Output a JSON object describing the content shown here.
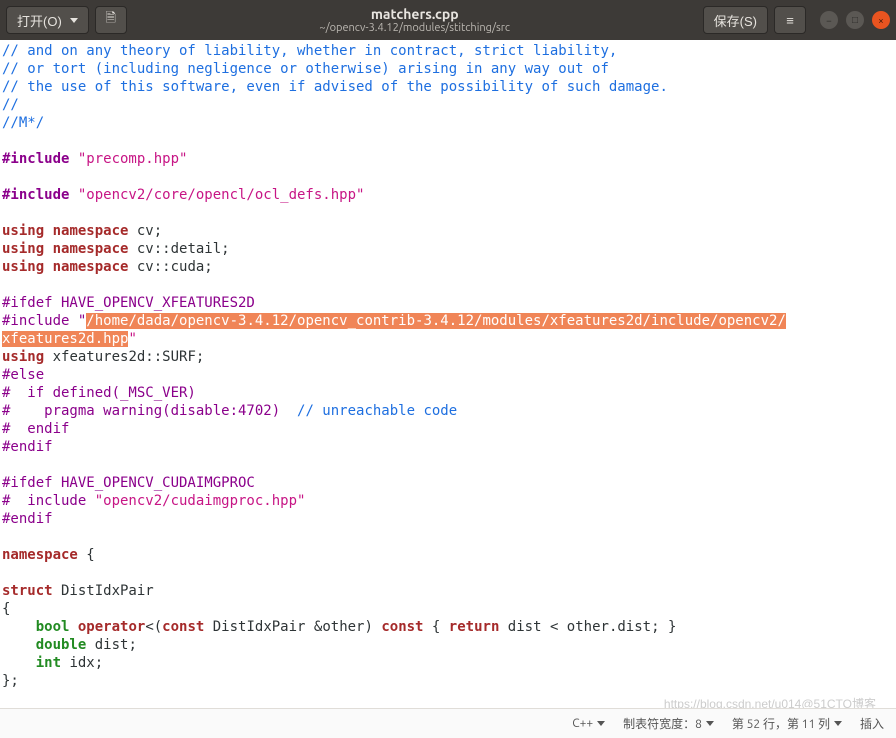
{
  "titlebar": {
    "open_label": "打开(O)",
    "save_label": "保存(S)",
    "title": "matchers.cpp",
    "subtitle": "~/opencv-3.4.12/modules/stitching/src"
  },
  "code": {
    "c1": "// and on any theory of liability, whether in contract, strict liability,",
    "c2": "// or tort (including negligence or otherwise) arising in any way out of",
    "c3": "// the use of this software, even if advised of the possibility of such damage.",
    "c4": "//",
    "c5": "//M*/",
    "inc1_dir": "#include ",
    "inc1_str": "\"precomp.hpp\"",
    "inc2_str": "\"opencv2/core/opencl/ocl_defs.hpp\"",
    "using": "using",
    "namespace": "namespace",
    "ns_cv": " cv;",
    "ns_detail": " cv::detail;",
    "ns_cuda": " cv::cuda;",
    "ifdef1": "#ifdef HAVE_OPENCV_XFEATURES2D",
    "inc3_pre": "#include \"",
    "hl_path": "/home/dada/opencv-3.4.12/opencv_contrib-3.4.12/modules/xfeatures2d/include/opencv2/",
    "hl_path2": "xfeatures2d.hpp",
    "inc3_post": "\"",
    "using_surf": " xfeatures2d::SURF;",
    "else": "#else",
    "ifmsc": "#  if defined(_MSC_VER)",
    "pragma": "#    pragma warning(disable:4702)",
    "pragma_cmt": "  // unreachable code",
    "endif_inner": "#  endif",
    "endif": "#endif",
    "ifdef2": "#ifdef HAVE_OPENCV_CUDAIMGPROC",
    "inc4_pre": "#  include ",
    "inc4_str": "\"opencv2/cudaimgproc.hpp\"",
    "ns_open": " {",
    "struct": "struct",
    "struct_name": " DistIdxPair",
    "brace_open": "{",
    "bool": "bool",
    "operator": "operator",
    "lt": "<(",
    "const": "const",
    "param": " DistIdxPair &other) ",
    "const2": "const",
    "body_open": " { ",
    "return": "return",
    "body": " dist < other.dist; }",
    "double": "double",
    "dist": " dist;",
    "int": "int",
    "idx": " idx;",
    "brace_close": "};"
  },
  "statusbar": {
    "lang": "C++",
    "tabwidth": "制表符宽度：8",
    "position": "第 52 行，第 11 列",
    "mode": "插入"
  },
  "watermark": "https://blog.csdn.net/u014@51CTO博客"
}
